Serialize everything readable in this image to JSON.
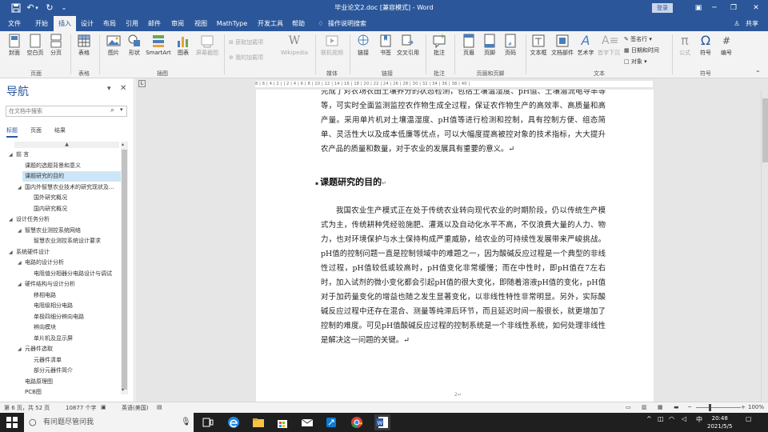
{
  "window": {
    "title": "毕业论文2.doc [兼容模式] - Word",
    "login": "登录",
    "colors": {
      "brand": "#2b579a",
      "ribbon": "#f3f3f3",
      "selection": "#cde6f7",
      "taskbar": "#1f1f1f"
    }
  },
  "quick_access": {
    "save_icon": "save-icon",
    "undo_icon": "undo-icon",
    "redo_icon": "redo-icon"
  },
  "tabs": [
    "文件",
    "开始",
    "插入",
    "设计",
    "布局",
    "引用",
    "邮件",
    "审阅",
    "视图",
    "MathType",
    "开发工具",
    "帮助"
  ],
  "active_tab": "插入",
  "tell_me": "操作说明搜索",
  "share": "共享",
  "ribbon": {
    "pages": {
      "cover": "封面",
      "blank": "空白页",
      "break": "分页",
      "group": "页面"
    },
    "tables": {
      "table": "表格",
      "group": "表格"
    },
    "illustrations": {
      "picture": "图片",
      "shapes": "形状",
      "smartart": "SmartArt",
      "chart": "图表",
      "screenshot": "屏幕截图",
      "group": "插图"
    },
    "addins": {
      "get": "获取加载项",
      "my": "我的加载项",
      "wikipedia": "Wikipedia"
    },
    "media": {
      "video": "联机视频",
      "group": "媒体"
    },
    "links": {
      "link": "链接",
      "bookmark": "书签",
      "xref": "交叉引用",
      "group": "链接"
    },
    "comments": {
      "comment": "批注",
      "group": "批注"
    },
    "header_footer": {
      "header": "页眉",
      "footer": "页脚",
      "page_number": "页码",
      "group": "页眉和页脚"
    },
    "text": {
      "textbox": "文本框",
      "quickparts": "文档部件",
      "wordart": "艺术字",
      "dropcap": "首字下沉",
      "signature": "签名行",
      "datetime": "日期和时间",
      "object": "对象",
      "group": "文本"
    },
    "symbols": {
      "equation": "公式",
      "symbol": "符号",
      "number": "编号",
      "group": "符号"
    }
  },
  "nav": {
    "title": "导航",
    "search_placeholder": "在文档中搜索",
    "tabs": [
      "标题",
      "页面",
      "结果"
    ],
    "active_tab": "标题",
    "header_arrow": "▲",
    "items": [
      {
        "label": "前 言",
        "level": 0,
        "expand": "◢"
      },
      {
        "label": "课题的选题背景和意义",
        "level": 1,
        "expand": ""
      },
      {
        "label": "课题研究的目的",
        "level": 1,
        "expand": "",
        "selected": true
      },
      {
        "label": "国内外智慧农业技术的研究现状及...",
        "level": 1,
        "expand": "◢"
      },
      {
        "label": "国外研究概况",
        "level": 2,
        "expand": ""
      },
      {
        "label": "国内研究概况",
        "level": 2,
        "expand": ""
      },
      {
        "label": "设计任务分析",
        "level": 0,
        "expand": "◢"
      },
      {
        "label": "智慧农业测控系统网络",
        "level": 1,
        "expand": "◢"
      },
      {
        "label": "智慧农业测控系统设计要求",
        "level": 2,
        "expand": ""
      },
      {
        "label": "系统硬件设计",
        "level": 0,
        "expand": "◢"
      },
      {
        "label": "电路的设计分析",
        "level": 1,
        "expand": "◢"
      },
      {
        "label": "电阻值分相器分电路设计与调试",
        "level": 2,
        "expand": ""
      },
      {
        "label": "硬件结构与设计分析",
        "level": 1,
        "expand": "◢"
      },
      {
        "label": "移相电路",
        "level": 2,
        "expand": ""
      },
      {
        "label": "电阻级相分电路",
        "level": 2,
        "expand": ""
      },
      {
        "label": "单极四细分辨向电路",
        "level": 2,
        "expand": ""
      },
      {
        "label": "辨向模块",
        "level": 2,
        "expand": ""
      },
      {
        "label": "单片机及显示屏",
        "level": 2,
        "expand": ""
      },
      {
        "label": "元器件选取",
        "level": 1,
        "expand": "◢"
      },
      {
        "label": "元器件清单",
        "level": 2,
        "expand": ""
      },
      {
        "label": "部分元器件简介",
        "level": 2,
        "expand": ""
      },
      {
        "label": "电路原理图",
        "level": 1,
        "expand": ""
      },
      {
        "label": "PCB图",
        "level": 1,
        "expand": ""
      }
    ]
  },
  "ruler": "8 | 6 | 4 | 2 |   | 2 | 4 | 6 | 8 | 10 | 12 | 14 | 16 | 18 | 20 | 22 | 24 | 26 | 28 | 30 | 32 | 34 | 36 | 38 | 40 |",
  "document": {
    "para_top": "完成了对农场农田土壤养分的状态检测，包括土壤温湿度、pH值、土壤潜流电导率等等，可实时全面监测监控农作物生成全过程，保证农作物生产的高效率、高质量和高产量。采用单片机对土壤温湿度、pH值等进行检测和控制，具有控制方便、组态简单、灵活性大以及成本低廉等优点，可以大幅度提高被控对象的技术指标，大大提升农产品的质量和数量，对于农业的发展具有重要的意义。↵",
    "heading": "课题研究的目的",
    "para_main": "我国农业生产模式正在处于传统农业转向现代农业的时期阶段，仍以传统生产模式为主，传统耕种凭经验施肥、灌溉以及自动化水平不高，不仅浪费大量的人力、物力，也对环境保护与水土保持构成严重威胁，给农业的可持续性发展带来严峻挑战。pH值的控制问题一直是控制领域中的难题之一，因为酸碱反应过程是一个典型的非线性过程，pH值较低或较高时，pH值变化非常缓慢；而在中性时，即pH值在7左右时，加入试剂的微小变化都会引起pH值的很大变化，即随着溶液pH值的变化，pH值对于加药量变化的增益也随之发生显著变化，以非线性特性非常明显。另外，实际酸碱反应过程中还存在混合、测量等纯滞后环节，而且延迟时间一般很长，就更增加了控制的难度。可见pH值酸碱反应过程的控制系统是一个非线性系统，如何处理非线性是解决这一问题的关键。↵",
    "page_number": "2↵"
  },
  "status": {
    "page": "第 6 页，共 52 页",
    "words": "10877 个字",
    "language": "英语(美国)",
    "zoom": "100%"
  },
  "taskbar": {
    "search": "有问题尽管问我",
    "ime": "中",
    "time": "20:48",
    "date": "2021/5/5"
  }
}
